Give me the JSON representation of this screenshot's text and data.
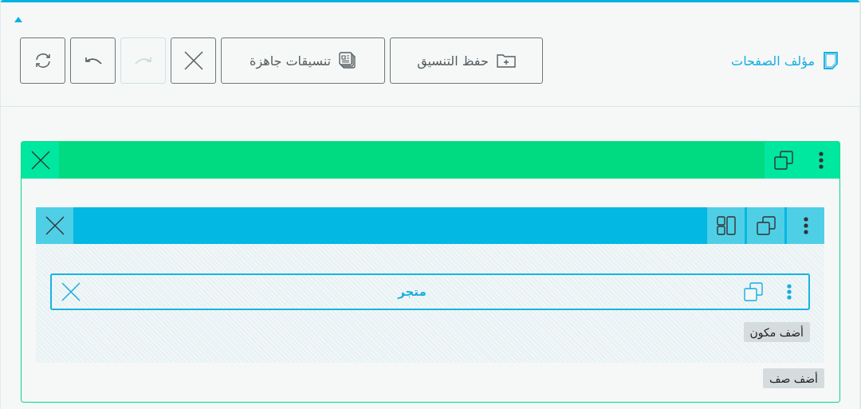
{
  "header": {
    "title": "مؤلف الصفحات"
  },
  "toolbar": [
    {
      "kind": "save",
      "label": "حفظ التنسيق",
      "disabled": false
    },
    {
      "kind": "presets",
      "label": "تنسيقات جاهزة",
      "disabled": false
    },
    {
      "kind": "clear",
      "disabled": false
    },
    {
      "kind": "redo",
      "disabled": true
    },
    {
      "kind": "undo",
      "disabled": false
    },
    {
      "kind": "refresh",
      "disabled": false
    }
  ],
  "section": {
    "rows": [
      {
        "modules": [
          {
            "title": "متجر"
          }
        ],
        "add_module": "أضف مكون"
      }
    ],
    "add_row": "أضف صف"
  }
}
